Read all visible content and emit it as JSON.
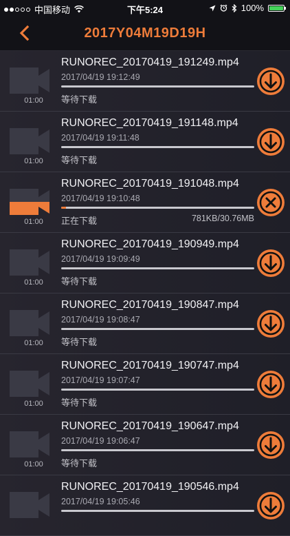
{
  "status_bar": {
    "carrier": "中国移动",
    "time": "下午5:24",
    "battery_percent": "100%",
    "signal_bars_filled": 2,
    "signal_bars_total": 5
  },
  "nav": {
    "title": "2017Y04M19D19H",
    "back_icon": "chevron-left-icon"
  },
  "colors": {
    "accent": "#ee7c3a",
    "background": "#1f1f24",
    "battery": "#45d35a"
  },
  "recordings": [
    {
      "name": "RUNOREC_20170419_191249.mp4",
      "date": "2017/04/19 19:12:49",
      "duration": "01:00",
      "status": "等待下载",
      "size": "",
      "progress": 0,
      "action": "download",
      "downloading": false
    },
    {
      "name": "RUNOREC_20170419_191148.mp4",
      "date": "2017/04/19 19:11:48",
      "duration": "01:00",
      "status": "等待下载",
      "size": "",
      "progress": 0,
      "action": "download",
      "downloading": false
    },
    {
      "name": "RUNOREC_20170419_191048.mp4",
      "date": "2017/04/19 19:10:48",
      "duration": "01:00",
      "status": "正在下载",
      "size": "781KB/30.76MB",
      "progress": 0.025,
      "action": "cancel",
      "downloading": true
    },
    {
      "name": "RUNOREC_20170419_190949.mp4",
      "date": "2017/04/19 19:09:49",
      "duration": "01:00",
      "status": "等待下载",
      "size": "",
      "progress": 0,
      "action": "download",
      "downloading": false
    },
    {
      "name": "RUNOREC_20170419_190847.mp4",
      "date": "2017/04/19 19:08:47",
      "duration": "01:00",
      "status": "等待下载",
      "size": "",
      "progress": 0,
      "action": "download",
      "downloading": false
    },
    {
      "name": "RUNOREC_20170419_190747.mp4",
      "date": "2017/04/19 19:07:47",
      "duration": "01:00",
      "status": "等待下载",
      "size": "",
      "progress": 0,
      "action": "download",
      "downloading": false
    },
    {
      "name": "RUNOREC_20170419_190647.mp4",
      "date": "2017/04/19 19:06:47",
      "duration": "01:00",
      "status": "等待下载",
      "size": "",
      "progress": 0,
      "action": "download",
      "downloading": false
    },
    {
      "name": "RUNOREC_20170419_190546.mp4",
      "date": "2017/04/19 19:05:46",
      "duration": "",
      "status": "",
      "size": "",
      "progress": 0,
      "action": "download",
      "downloading": false
    }
  ]
}
